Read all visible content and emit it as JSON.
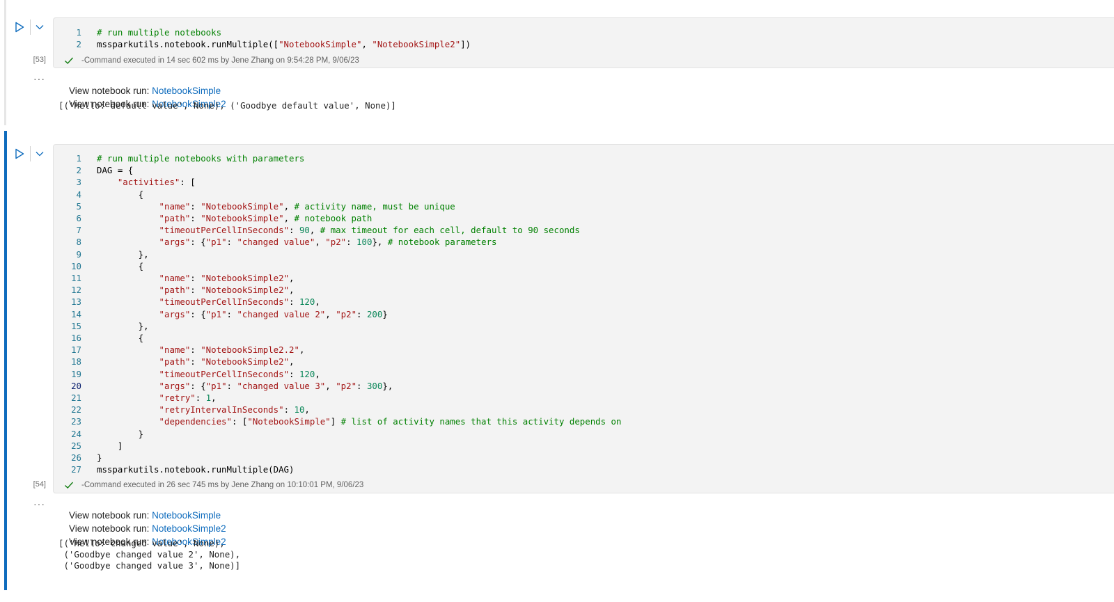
{
  "cell1": {
    "exec_count": "[53]",
    "code_lines": [
      [
        {
          "t": "# run multiple notebooks",
          "c": "c"
        }
      ],
      [
        {
          "t": "mssparkutils.notebook.runMultiple(["
        },
        {
          "t": "\"NotebookSimple\"",
          "c": "s"
        },
        {
          "t": ", "
        },
        {
          "t": "\"NotebookSimple2\"",
          "c": "s"
        },
        {
          "t": "])"
        }
      ]
    ],
    "status": "-Command executed in 14 sec 602 ms by Jene Zhang on 9:54:28 PM, 9/06/23",
    "output": {
      "run_label": "View notebook run: ",
      "links": [
        "NotebookSimple",
        "NotebookSimple2"
      ],
      "result": "[('Hello: default value', None), ('Goodbye default value', None)]"
    }
  },
  "cell2": {
    "exec_count": "[54]",
    "current_line": 20,
    "code_lines": [
      [
        {
          "t": "# run multiple notebooks with parameters",
          "c": "c"
        }
      ],
      [
        {
          "t": "DAG = {"
        }
      ],
      [
        {
          "t": "    "
        },
        {
          "t": "\"activities\"",
          "c": "s"
        },
        {
          "t": ": ["
        }
      ],
      [
        {
          "t": "        {"
        }
      ],
      [
        {
          "t": "            "
        },
        {
          "t": "\"name\"",
          "c": "s"
        },
        {
          "t": ": "
        },
        {
          "t": "\"NotebookSimple\"",
          "c": "s"
        },
        {
          "t": ", "
        },
        {
          "t": "# activity name, must be unique",
          "c": "c"
        }
      ],
      [
        {
          "t": "            "
        },
        {
          "t": "\"path\"",
          "c": "s"
        },
        {
          "t": ": "
        },
        {
          "t": "\"NotebookSimple\"",
          "c": "s"
        },
        {
          "t": ", "
        },
        {
          "t": "# notebook path",
          "c": "c"
        }
      ],
      [
        {
          "t": "            "
        },
        {
          "t": "\"timeoutPerCellInSeconds\"",
          "c": "s"
        },
        {
          "t": ": "
        },
        {
          "t": "90",
          "c": "n"
        },
        {
          "t": ", "
        },
        {
          "t": "# max timeout for each cell, default to 90 seconds",
          "c": "c"
        }
      ],
      [
        {
          "t": "            "
        },
        {
          "t": "\"args\"",
          "c": "s"
        },
        {
          "t": ": {"
        },
        {
          "t": "\"p1\"",
          "c": "s"
        },
        {
          "t": ": "
        },
        {
          "t": "\"changed value\"",
          "c": "s"
        },
        {
          "t": ", "
        },
        {
          "t": "\"p2\"",
          "c": "s"
        },
        {
          "t": ": "
        },
        {
          "t": "100",
          "c": "n"
        },
        {
          "t": "}, "
        },
        {
          "t": "# notebook parameters",
          "c": "c"
        }
      ],
      [
        {
          "t": "        },"
        }
      ],
      [
        {
          "t": "        {"
        }
      ],
      [
        {
          "t": "            "
        },
        {
          "t": "\"name\"",
          "c": "s"
        },
        {
          "t": ": "
        },
        {
          "t": "\"NotebookSimple2\"",
          "c": "s"
        },
        {
          "t": ","
        }
      ],
      [
        {
          "t": "            "
        },
        {
          "t": "\"path\"",
          "c": "s"
        },
        {
          "t": ": "
        },
        {
          "t": "\"NotebookSimple2\"",
          "c": "s"
        },
        {
          "t": ","
        }
      ],
      [
        {
          "t": "            "
        },
        {
          "t": "\"timeoutPerCellInSeconds\"",
          "c": "s"
        },
        {
          "t": ": "
        },
        {
          "t": "120",
          "c": "n"
        },
        {
          "t": ","
        }
      ],
      [
        {
          "t": "            "
        },
        {
          "t": "\"args\"",
          "c": "s"
        },
        {
          "t": ": {"
        },
        {
          "t": "\"p1\"",
          "c": "s"
        },
        {
          "t": ": "
        },
        {
          "t": "\"changed value 2\"",
          "c": "s"
        },
        {
          "t": ", "
        },
        {
          "t": "\"p2\"",
          "c": "s"
        },
        {
          "t": ": "
        },
        {
          "t": "200",
          "c": "n"
        },
        {
          "t": "}"
        }
      ],
      [
        {
          "t": "        },"
        }
      ],
      [
        {
          "t": "        {"
        }
      ],
      [
        {
          "t": "            "
        },
        {
          "t": "\"name\"",
          "c": "s"
        },
        {
          "t": ": "
        },
        {
          "t": "\"NotebookSimple2.2\"",
          "c": "s"
        },
        {
          "t": ","
        }
      ],
      [
        {
          "t": "            "
        },
        {
          "t": "\"path\"",
          "c": "s"
        },
        {
          "t": ": "
        },
        {
          "t": "\"NotebookSimple2\"",
          "c": "s"
        },
        {
          "t": ","
        }
      ],
      [
        {
          "t": "            "
        },
        {
          "t": "\"timeoutPerCellInSeconds\"",
          "c": "s"
        },
        {
          "t": ": "
        },
        {
          "t": "120",
          "c": "n"
        },
        {
          "t": ","
        }
      ],
      [
        {
          "t": "            "
        },
        {
          "t": "\"args\"",
          "c": "s"
        },
        {
          "t": ": {"
        },
        {
          "t": "\"p1\"",
          "c": "s"
        },
        {
          "t": ": "
        },
        {
          "t": "\"changed value 3\"",
          "c": "s"
        },
        {
          "t": ", "
        },
        {
          "t": "\"p2\"",
          "c": "s"
        },
        {
          "t": ": "
        },
        {
          "t": "300",
          "c": "n"
        },
        {
          "t": "},"
        }
      ],
      [
        {
          "t": "            "
        },
        {
          "t": "\"retry\"",
          "c": "s"
        },
        {
          "t": ": "
        },
        {
          "t": "1",
          "c": "n"
        },
        {
          "t": ","
        }
      ],
      [
        {
          "t": "            "
        },
        {
          "t": "\"retryIntervalInSeconds\"",
          "c": "s"
        },
        {
          "t": ": "
        },
        {
          "t": "10",
          "c": "n"
        },
        {
          "t": ","
        }
      ],
      [
        {
          "t": "            "
        },
        {
          "t": "\"dependencies\"",
          "c": "s"
        },
        {
          "t": ": ["
        },
        {
          "t": "\"NotebookSimple\"",
          "c": "s"
        },
        {
          "t": "] "
        },
        {
          "t": "# list of activity names that this activity depends on",
          "c": "c"
        }
      ],
      [
        {
          "t": "        }"
        }
      ],
      [
        {
          "t": "    ]"
        }
      ],
      [
        {
          "t": "}"
        }
      ],
      [
        {
          "t": "mssparkutils.notebook.runMultiple(DAG)"
        }
      ]
    ],
    "status": "-Command executed in 26 sec 745 ms by Jene Zhang on 10:10:01 PM, 9/06/23",
    "output": {
      "run_label": "View notebook run: ",
      "links": [
        "NotebookSimple",
        "NotebookSimple2",
        "NotebookSimple2"
      ],
      "result": "[('Hello: changed value', None),\n ('Goodbye changed value 2', None),\n ('Goodbye changed value 3', None)]"
    }
  },
  "icons": {
    "run": "play-icon",
    "collapse": "chevron-down-icon",
    "success": "checkmark-icon",
    "more": "more-dots-icon"
  },
  "colors": {
    "accent": "#0f6cbd",
    "comment": "#008000",
    "string": "#a31515",
    "number": "#098658",
    "line_number": "#237893",
    "success": "#107c10"
  }
}
